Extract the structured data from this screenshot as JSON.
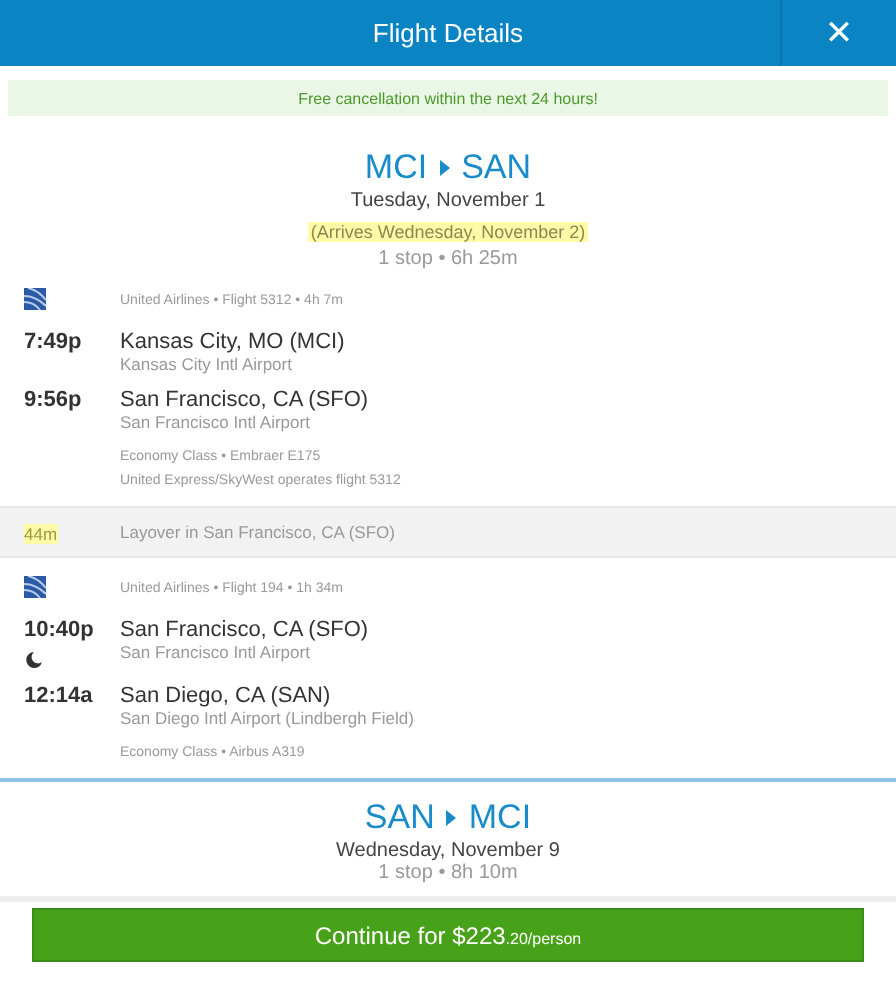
{
  "header": {
    "title": "Flight Details",
    "close": "✕"
  },
  "banner": "Free cancellation within the next 24 hours!",
  "legs": [
    {
      "from": "MCI",
      "to": "SAN",
      "date": "Tuesday, November 1",
      "arrives": "(Arrives Wednesday, November 2)",
      "summary": "1 stop • 6h 25m",
      "expanded": true,
      "segments": [
        {
          "kind": "flight",
          "info": "United Airlines • Flight 5312 • 4h 7m",
          "overnight": false,
          "depart_time": "7:49p",
          "depart_city": "Kansas City, MO (MCI)",
          "depart_airport": "Kansas City Intl Airport",
          "arrive_time": "9:56p",
          "arrive_city": "San Francisco, CA (SFO)",
          "arrive_airport": "San Francisco Intl Airport",
          "notes": [
            "Economy Class • Embraer E175",
            "United Express/SkyWest operates flight 5312"
          ]
        },
        {
          "kind": "layover",
          "duration": "44m",
          "text": "Layover in San Francisco, CA (SFO)"
        },
        {
          "kind": "flight",
          "info": "United Airlines • Flight 194 • 1h 34m",
          "overnight": true,
          "depart_time": "10:40p",
          "depart_city": "San Francisco, CA (SFO)",
          "depart_airport": "San Francisco Intl Airport",
          "arrive_time": "12:14a",
          "arrive_city": "San Diego, CA (SAN)",
          "arrive_airport": "San Diego Intl Airport (Lindbergh Field)",
          "notes": [
            "Economy Class • Airbus A319"
          ]
        }
      ]
    },
    {
      "from": "SAN",
      "to": "MCI",
      "date": "Wednesday, November 9",
      "summary": "1 stop • 8h 10m",
      "expanded": false
    }
  ],
  "continue": {
    "label": "Continue for $223",
    "suffix": ".20/person"
  }
}
